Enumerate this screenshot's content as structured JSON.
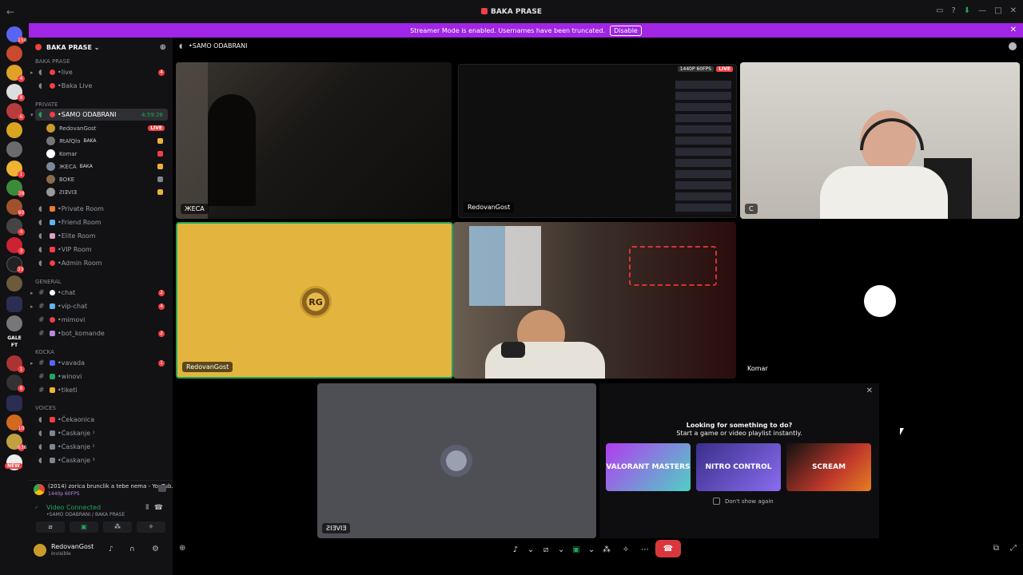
{
  "window": {
    "title": "BAKA PRASE"
  },
  "banner": {
    "text": "Streamer Mode is enabled. Usernames have been truncated.",
    "button": "Disable"
  },
  "server_badges": [
    "158",
    "4",
    "8",
    "6",
    "1",
    "38",
    "90",
    "4",
    "3",
    "33",
    "1",
    "8",
    "10",
    "636"
  ],
  "server_misc": {
    "gale_label": "GALE FT",
    "new_label": "NEW"
  },
  "guild": {
    "name": "BAKA PRASE",
    "category_top": "BAKA PRASE"
  },
  "channels_top": [
    {
      "name": "•live",
      "count": "4"
    },
    {
      "name": "•Baka Live"
    }
  ],
  "private_category": "PRIVATE",
  "active_channel": {
    "name": "•SAMO ODABRANI",
    "timer": "4:59:26"
  },
  "voice_users": [
    {
      "name": "RedovanGost",
      "live": "LIVE",
      "tag": ""
    },
    {
      "name": "ЯtAfQlɘ",
      "tag": "BAKA"
    },
    {
      "name": "Komar",
      "tag": ""
    },
    {
      "name": "ЖЕCA",
      "tag": "BAKA"
    },
    {
      "name": "BOKE",
      "tag": ""
    },
    {
      "name": "ƧIƎVIƎ",
      "tag": ""
    }
  ],
  "private_rooms": [
    "•Private Room",
    "•Friend Room",
    "•Elite Room",
    "•VIP Room",
    "•Admin Room"
  ],
  "general_category": "GENERAL",
  "general_channels": [
    {
      "name": "•chat",
      "count": "2"
    },
    {
      "name": "•vip-chat",
      "count": "4"
    },
    {
      "name": "•mimovi"
    },
    {
      "name": "•bot_komande",
      "count": "2"
    }
  ],
  "kocka_category": "KOCKA",
  "kocka_channels": [
    {
      "name": "•vavada",
      "count": "1"
    },
    {
      "name": "•winovi"
    },
    {
      "name": "•tiketi"
    }
  ],
  "voices_category": "VOICES",
  "voices_channels": [
    "•Čekaonica",
    "•Ćaskanje ¹",
    "•Ćaskanje ²",
    "•Ćaskanje ³"
  ],
  "now_playing": {
    "title": "(2014) zorica brunclik a tebe nema - YouTub...",
    "sub": "1440p 60FPS"
  },
  "voice_status": {
    "title": "Video Connected",
    "sub": "•SAMO ODABRANI / BAKA PRASE"
  },
  "user": {
    "name": "RedovanGost",
    "status": "Invisible"
  },
  "call": {
    "channel": "•SAMO ODABRANI",
    "tiles": [
      {
        "name": "ЖЕCA"
      },
      {
        "name": "RedovanGost",
        "stream_badge": "1440P 60FPS",
        "live": "LIVE"
      },
      {
        "name": "C"
      },
      {
        "name": "RedovanGost"
      },
      {
        "name": ""
      },
      {
        "name": "Komar"
      },
      {
        "name": "ƧIƎVIƎ"
      }
    ],
    "rg_logo": "RG"
  },
  "activity": {
    "title": "Looking for something to do?",
    "subtitle": "Start a game or video playlist instantly.",
    "games": [
      "VALORANT MASTERS",
      "NITRO CONTROL",
      "SCREAM"
    ],
    "checkbox": "Don't show again"
  }
}
